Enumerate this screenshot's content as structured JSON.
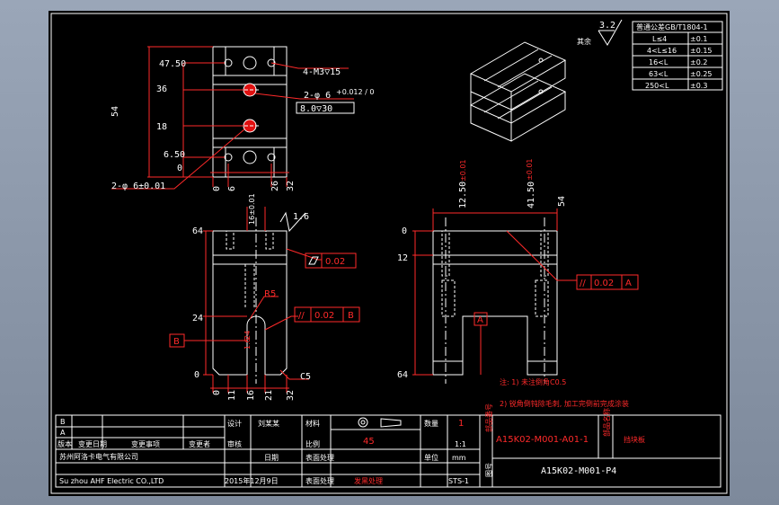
{
  "notes": {
    "n1": "注: 1) 未注倒角C0.5",
    "n2": "2) 锐角倒钝除毛刺, 加工完倒前完成涂装"
  },
  "surface": {
    "general": "3.2",
    "general_label": "其余",
    "view_mark": "1.6"
  },
  "tolerance_table": {
    "header": "普通公差GB/T1804-1",
    "rows": [
      {
        "range": "L≤4",
        "value": "±0.1"
      },
      {
        "range": "4<L≤16",
        "value": "±0.15"
      },
      {
        "range": "16<L",
        "value": "±0.2"
      },
      {
        "range": "63<L",
        "value": "±0.25"
      },
      {
        "range": "250<L",
        "value": "±0.3"
      }
    ]
  },
  "top_view": {
    "holes_note": "4-M3▽15",
    "pin_note": "2-φ 6",
    "pin_fit": "+0.012 / 0",
    "pin_depth": "8.0▽30",
    "pin_tol": "2-φ 6±0.01",
    "left_dims": [
      "47.50",
      "36",
      "18",
      "6.50",
      "0"
    ],
    "height": "54",
    "bottom_dims": [
      "0",
      "6",
      "26",
      "32"
    ]
  },
  "front_view": {
    "dim_16": "16±0.01",
    "left_dims": [
      "64",
      "24",
      "0"
    ],
    "r5": "R5",
    "d16": "1.6",
    "b_label": "B",
    "flatness": "0.02",
    "parallel": "0.02",
    "parallel_ref": "B",
    "c5": "C5",
    "bottom_dims": [
      "0",
      "11",
      "16",
      "21",
      "32"
    ],
    "d24": "24"
  },
  "side_view": {
    "top_dims": [
      "12.50",
      "41.50",
      "54"
    ],
    "top_tol_a": "±0.01",
    "top_tol_b": "±0.01",
    "left_dims": [
      "0",
      "12",
      "64"
    ],
    "datum": "A",
    "parallel": "0.02",
    "parallel_ref": "A"
  },
  "title_block": {
    "rev_b": "B",
    "rev_a": "A",
    "cols": [
      "版本",
      "变更日期",
      "变更事项",
      "变更者"
    ],
    "design_label": "设计",
    "designer": "刘某某",
    "qty_label": "数量",
    "qty": "1",
    "check_label": "审核",
    "date_label": "日期",
    "material_label": "材料",
    "material": "45",
    "scale_label": "比例",
    "scale": "1:1",
    "surface_label": "表面处理",
    "unit_label": "单位",
    "unit": "mm",
    "trade_label": "表面处理",
    "trade": "发黑处理",
    "company_cn": "苏州阿洛卡电气有限公司",
    "company_en": "Su zhou AHF Electric CO.,LTD",
    "date": "2015年12月9日",
    "drawing_code": "STS-1",
    "part_label_a": "部品番号",
    "part_no": "A15K02-M001-A01-1",
    "name_label": "部品名称",
    "part_name": "挡块板",
    "drawing_no": "A15K02-M001-P4",
    "drawing_no_label": "图号"
  }
}
